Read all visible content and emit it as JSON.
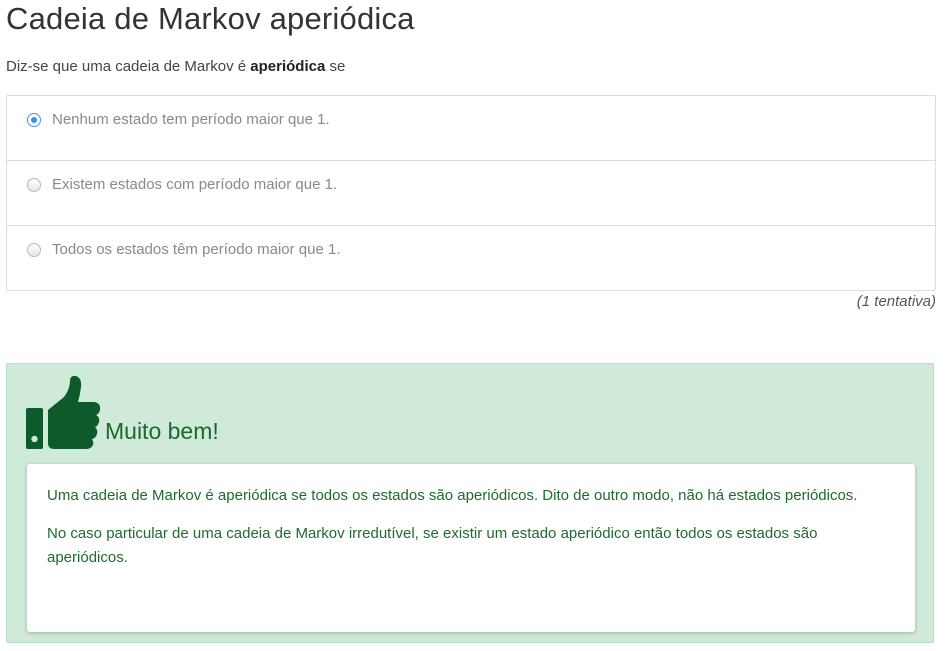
{
  "question": {
    "title": "Cadeia de Markov aperiódica",
    "prompt_prefix": "Diz-se que uma cadeia de Markov é ",
    "prompt_bold": "aperiódica",
    "prompt_suffix": " se",
    "options": [
      {
        "label": "Nenhum estado tem período maior que 1.",
        "selected": true
      },
      {
        "label": "Existem estados com período maior que 1.",
        "selected": false
      },
      {
        "label": "Todos os estados têm período maior que 1.",
        "selected": false
      }
    ],
    "attempts": "(1 tentativa)"
  },
  "feedback": {
    "icon": "thumbs-up-icon",
    "title": "Muito bem!",
    "paragraphs": [
      "Uma cadeia de Markov é aperiódica se todos os estados são aperiódicos. Dito de outro modo, não há estados periódicos.",
      "No caso particular de uma cadeia de Markov irredutível, se existir um estado aperiódico então todos os estados são aperiódicos."
    ],
    "colors": {
      "background": "#d0ead9",
      "text": "#1f6b2f",
      "icon": "#0e5a2a"
    }
  },
  "colors": {
    "radio_selected": "#3d8ee8",
    "option_text": "#8a8a8a"
  }
}
